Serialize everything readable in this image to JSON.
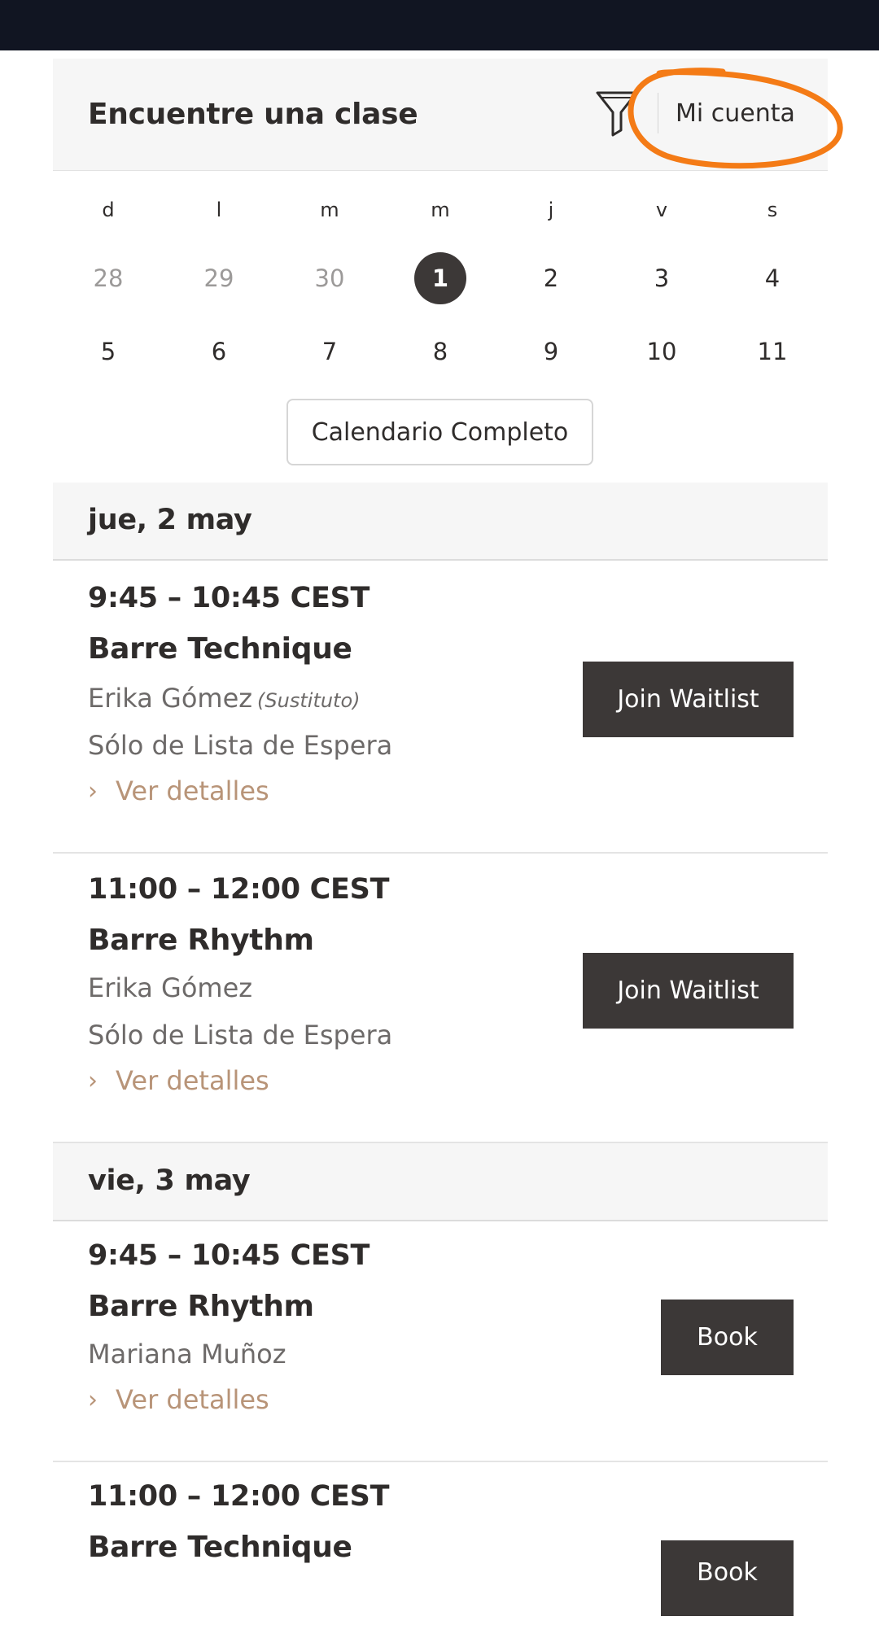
{
  "header": {
    "title": "Encuentre una clase",
    "account_label": "Mi cuenta",
    "filter_icon": "filter-icon"
  },
  "calendar": {
    "weekdays": [
      "d",
      "l",
      "m",
      "m",
      "j",
      "v",
      "s"
    ],
    "weeks": [
      [
        "28",
        "29",
        "30",
        "1",
        "2",
        "3",
        "4"
      ],
      [
        "5",
        "6",
        "7",
        "8",
        "9",
        "10",
        "11"
      ]
    ],
    "muted_days": [
      "28",
      "29",
      "30"
    ],
    "selected_day": "1",
    "full_calendar_label": "Calendario Completo"
  },
  "schedule": [
    {
      "date": "jue, 2 may",
      "classes": [
        {
          "time": "9:45 – 10:45 CEST",
          "name": "Barre Technique",
          "instructor": "Erika Gómez",
          "substitute_note": "(Sustituto)",
          "status": "Sólo de Lista de Espera",
          "details_label": "Ver detalles",
          "action_label": "Join Waitlist"
        },
        {
          "time": "11:00 – 12:00 CEST",
          "name": "Barre Rhythm",
          "instructor": "Erika Gómez",
          "status": "Sólo de Lista de Espera",
          "details_label": "Ver detalles",
          "action_label": "Join Waitlist"
        }
      ]
    },
    {
      "date": "vie, 3 may",
      "classes": [
        {
          "time": "9:45 – 10:45 CEST",
          "name": "Barre Rhythm",
          "instructor": "Mariana Muñoz",
          "details_label": "Ver detalles",
          "action_label": "Book"
        },
        {
          "time": "11:00 – 12:00 CEST",
          "name": "Barre Technique",
          "action_label": "Book"
        }
      ]
    }
  ],
  "colors": {
    "topbar": "#111522",
    "accent_link": "#b89478",
    "button_bg": "#3c3837",
    "annotation": "#f47b16"
  }
}
